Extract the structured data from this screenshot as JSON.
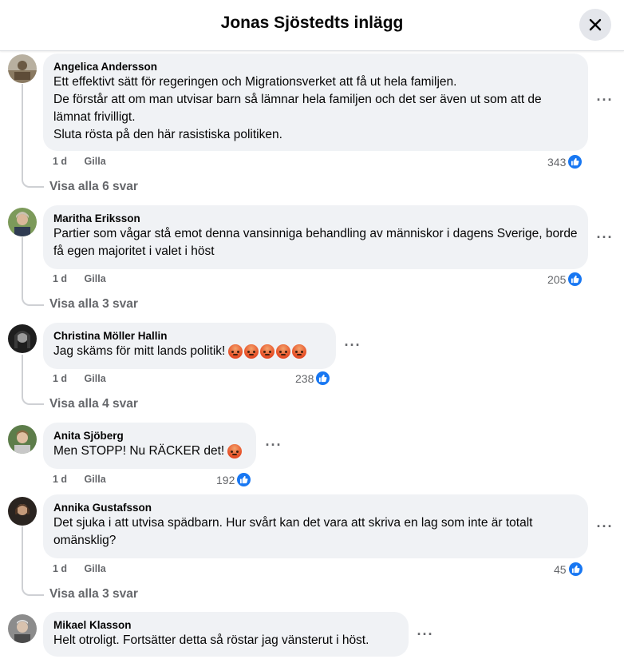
{
  "header": {
    "title": "Jonas Sjöstedts inlägg",
    "close_icon": "close-icon"
  },
  "comments": [
    {
      "author": "Angelica Andersson",
      "text": "Ett effektivt sätt för regeringen och Migrationsverket att få ut hela familjen.\nDe förstår att om man utvisar barn så lämnar hela familjen och det ser även ut som att de lämnat frivilligt.\nSluta rösta på den här rasistiska politiken.",
      "age": "1 d",
      "like_label": "Gilla",
      "reactions": "343",
      "replies": "Visa alla 6 svar"
    },
    {
      "author": "Maritha Eriksson",
      "text": "Partier som vågar stå emot denna vansinniga behandling av människor i dagens Sverige, borde få egen majoritet i valet i höst",
      "age": "1 d",
      "like_label": "Gilla",
      "reactions": "205",
      "replies": "Visa alla 3 svar"
    },
    {
      "author": "Christina Möller Hallin",
      "text": "Jag skäms för mitt lands politik!",
      "age": "1 d",
      "like_label": "Gilla",
      "reactions": "238",
      "replies": "Visa alla 4 svar"
    },
    {
      "author": "Anita Sjöberg",
      "text": "Men STOPP! Nu RÄCKER det!",
      "age": "1 d",
      "like_label": "Gilla",
      "reactions": "192"
    },
    {
      "author": "Annika Gustafsson",
      "text": "Det sjuka i att utvisa spädbarn. Hur svårt kan det vara att skriva en lag som inte är totalt omänsklig?",
      "age": "1 d",
      "like_label": "Gilla",
      "reactions": "45",
      "replies": "Visa alla 3 svar"
    },
    {
      "author": "Mikael Klasson",
      "text": "Helt otroligt. Fortsätter detta så röstar jag vänsterut i höst."
    }
  ],
  "colors": {
    "like_blue": "#1877f2",
    "bubble_bg": "#f0f2f5",
    "muted": "#65676b"
  }
}
